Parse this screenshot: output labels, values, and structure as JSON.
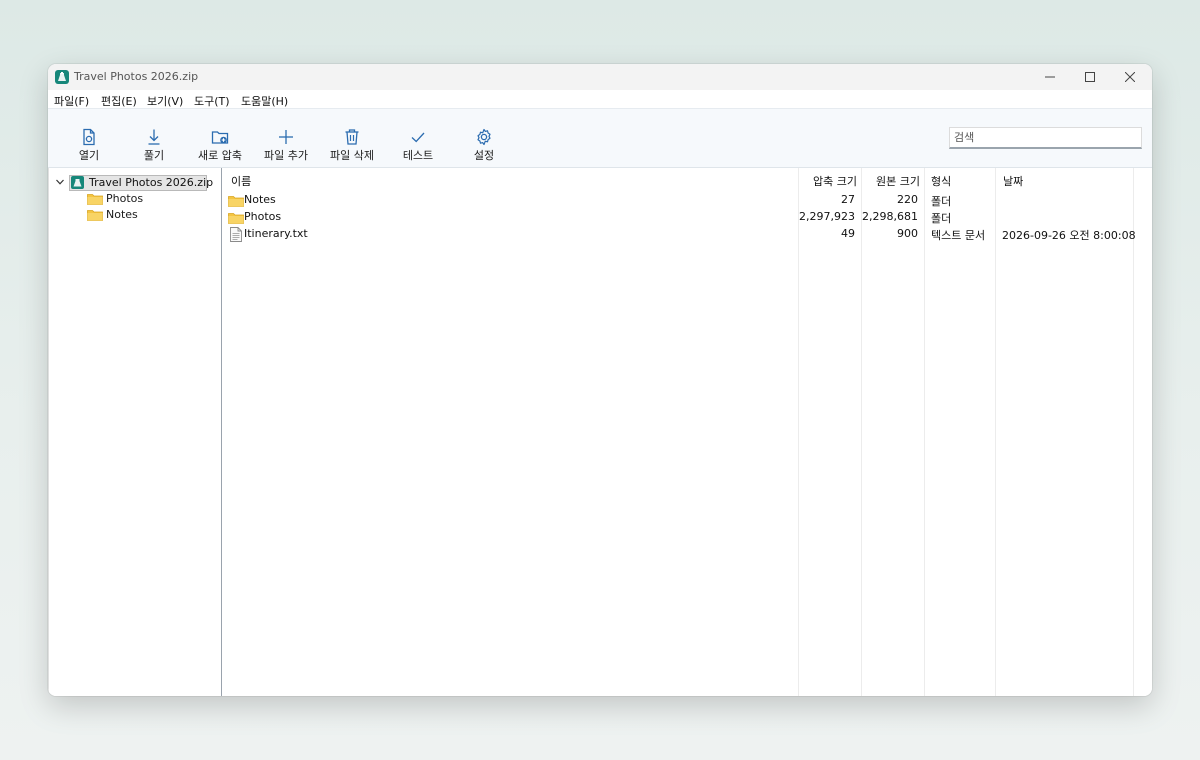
{
  "window": {
    "title": "Travel Photos 2026.zip"
  },
  "menu": [
    "파일(F)",
    "편집(E)",
    "보기(V)",
    "도구(T)",
    "도움말(H)"
  ],
  "toolbar": {
    "open": "열기",
    "extract": "풀기",
    "new_archive": "새로 압축",
    "add_files": "파일 추가",
    "delete_files": "파일 삭제",
    "test": "테스트",
    "settings": "설정"
  },
  "search": {
    "placeholder": "검색",
    "value": ""
  },
  "tree": {
    "root": "Travel Photos 2026.zip",
    "children": [
      "Photos",
      "Notes"
    ]
  },
  "list": {
    "headers": {
      "name": "이름",
      "packed": "압축 크기",
      "size": "원본 크기",
      "type": "형식",
      "date": "날짜"
    },
    "rows": [
      {
        "name": "Notes",
        "packed": "27",
        "size": "220",
        "type": "폴더",
        "date": "",
        "icon": "folder-icon"
      },
      {
        "name": "Photos",
        "packed": "2,297,923",
        "size": "2,298,681",
        "type": "폴더",
        "date": "",
        "icon": "folder-icon"
      },
      {
        "name": "Itinerary.txt",
        "packed": "49",
        "size": "900",
        "type": "텍스트 문서",
        "date": "2026-09-26 오전 8:00:08",
        "icon": "text-file-icon"
      }
    ]
  },
  "colors": {
    "accent": "#2b6cb0",
    "app_icon": "#16877a",
    "folder": "#f4c542"
  }
}
